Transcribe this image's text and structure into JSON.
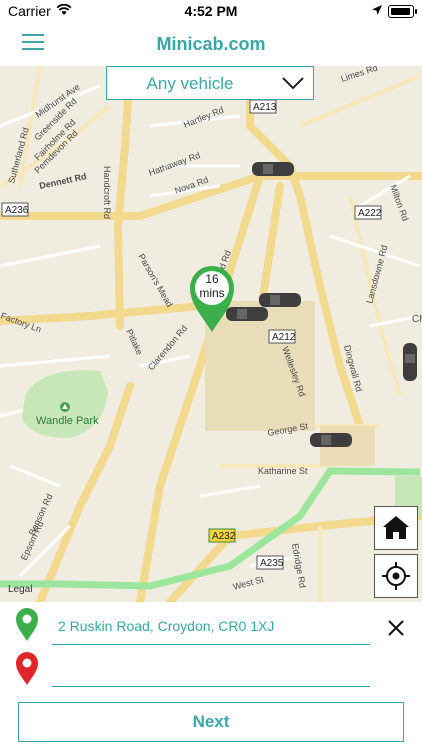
{
  "status": {
    "carrier": "Carrier",
    "time": "4:52 PM"
  },
  "header": {
    "title": "Minicab.com"
  },
  "vehicle_select": {
    "value": "Any vehicle"
  },
  "map": {
    "eta_value": "16",
    "eta_unit": "mins",
    "legal": "Legal",
    "streets": [
      "Hartley Rd",
      "Hathaway Rd",
      "Nova Rd",
      "Handcroft Rd",
      "Parson's Mead",
      "Oakfield Rd",
      "Clarendon Rd",
      "Pitlake",
      "Factory Ln",
      "Wellesley Rd",
      "Lansdowne Rd",
      "Dingwall Rd",
      "Milton Rd",
      "George St",
      "Katharine St",
      "Edridge Rd",
      "West St",
      "Epsom Rd",
      "Benson Rd",
      "Dennett Rd",
      "Midhurst Ave",
      "Greenside Rd",
      "Fairholme Rd",
      "Pemdevon Rd",
      "Sutherland Rd",
      "Limes Rd",
      "Wandle Park",
      "Ch"
    ],
    "road_badges": [
      "A213",
      "A236",
      "A222",
      "A212",
      "A232",
      "A235"
    ],
    "green_badge": "A232"
  },
  "form": {
    "pickup": "2 Ruskin Road, Croydon, CR0 1XJ",
    "destination": "",
    "next_label": "Next"
  },
  "colors": {
    "accent": "#3aa6a6",
    "pickup_pin": "#3cae4a",
    "dest_pin": "#e0262b"
  }
}
